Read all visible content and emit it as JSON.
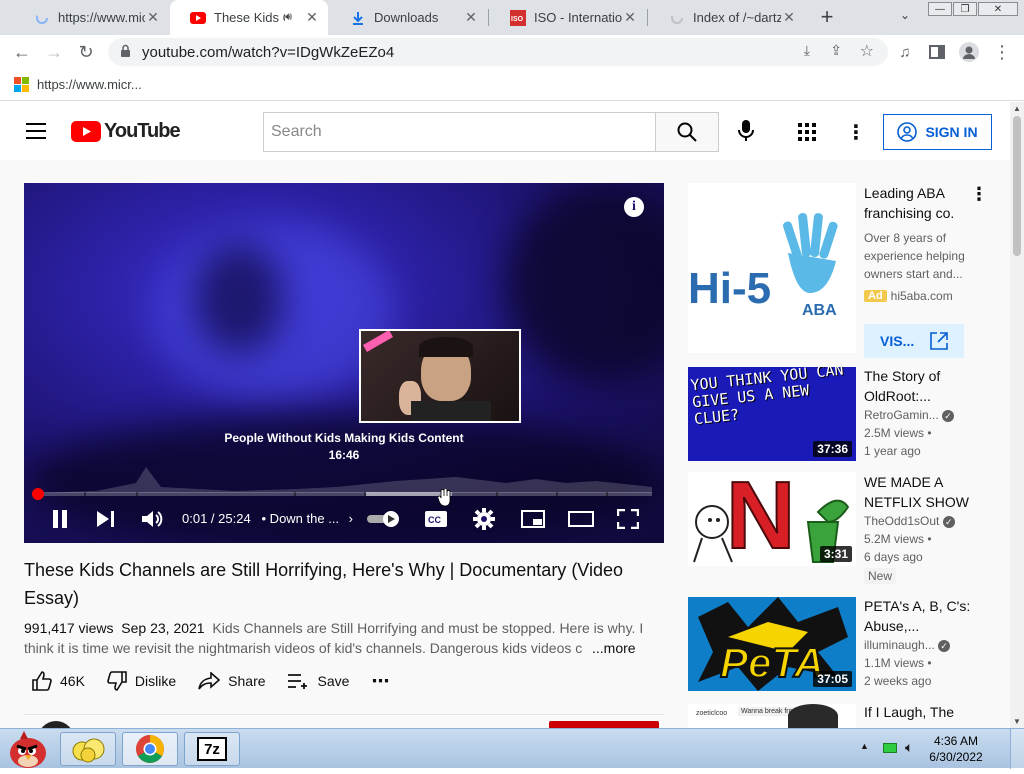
{
  "browser": {
    "tabs": [
      {
        "label": "https://www.mic",
        "icon": "edge-loading-icon",
        "active": false
      },
      {
        "label": "These Kids C",
        "icon": "youtube-icon",
        "active": true
      },
      {
        "label": "Downloads",
        "icon": "download-icon",
        "active": false
      },
      {
        "label": "ISO - Internation",
        "icon": "iso-icon",
        "active": false
      },
      {
        "label": "Index of /~dartz",
        "icon": "loading-icon",
        "active": false
      }
    ],
    "url": "youtube.com/watch?v=IDgWkZeEZo4",
    "bookmark": "https://www.micr..."
  },
  "youtube": {
    "logo_text": "YouTube",
    "search_placeholder": "Search",
    "signin_label": "SIGN IN",
    "player": {
      "preview_title": "People Without Kids Making Kids Content",
      "preview_time": "16:46",
      "current_time": "0:01 / 25:24",
      "chapter": "• Down the ...",
      "progress_fraction": 0.0
    },
    "video": {
      "title": "These Kids Channels are Still Horrifying, Here's Why | Documentary (Video Essay)",
      "views": "991,417 views",
      "date": "Sep 23, 2021",
      "description": "Kids Channels are Still Horrifying and must be stopped. Here is why. I think it is time we revisit the nightmarish videos of kid's channels. Dangerous kids videos c",
      "more_label": "...more",
      "likes": "46K",
      "dislike_label": "Dislike",
      "share_label": "Share",
      "save_label": "Save"
    },
    "ad": {
      "title": "Leading ABA franchising co.",
      "description": "Over 8 years of experience helping owners start and...",
      "badge": "Ad",
      "domain": "hi5aba.com",
      "cta": "VIS...",
      "logo_main": "Hi-5",
      "logo_sub": "ABA"
    },
    "related": [
      {
        "title": "The Story of OldRoot:...",
        "channel": "RetroGamin...",
        "views": "2.5M views •",
        "age": "1 year ago",
        "duration": "37:36",
        "verified": true,
        "badge": ""
      },
      {
        "title": "WE MADE A NETFLIX SHOW",
        "channel": "TheOdd1sOut",
        "views": "5.2M views •",
        "age": "6 days ago",
        "duration": "3:31",
        "verified": true,
        "badge": "New"
      },
      {
        "title": "PETA's A, B, C's: Abuse,...",
        "channel": "illuminaugh...",
        "views": "1.1M views •",
        "age": "2 weeks ago",
        "duration": "37:05",
        "verified": true,
        "badge": ""
      },
      {
        "title": "If I Laugh, The",
        "channel": "",
        "views": "",
        "age": "",
        "duration": "",
        "verified": false,
        "badge": ""
      }
    ],
    "thumb_text": {
      "oldroot": "YOU THINK YOU CAN GIVE US A NEW CLUE?",
      "peta": "PeTA",
      "netflix_letter": "N",
      "laugh_overlay": "Wanna break from the ads?",
      "laugh_channel": "zoeticlcoo"
    }
  },
  "taskbar": {
    "time": "4:36 AM",
    "date": "6/30/2022",
    "apps": [
      "angry-birds-icon",
      "yellow-app-icon",
      "chrome-icon",
      "7zip-icon"
    ],
    "zip_label": "7z"
  },
  "colors": {
    "youtube_red": "#ff0000",
    "link_blue": "#065fd4",
    "chrome_tab_bg": "#dee1e6"
  }
}
